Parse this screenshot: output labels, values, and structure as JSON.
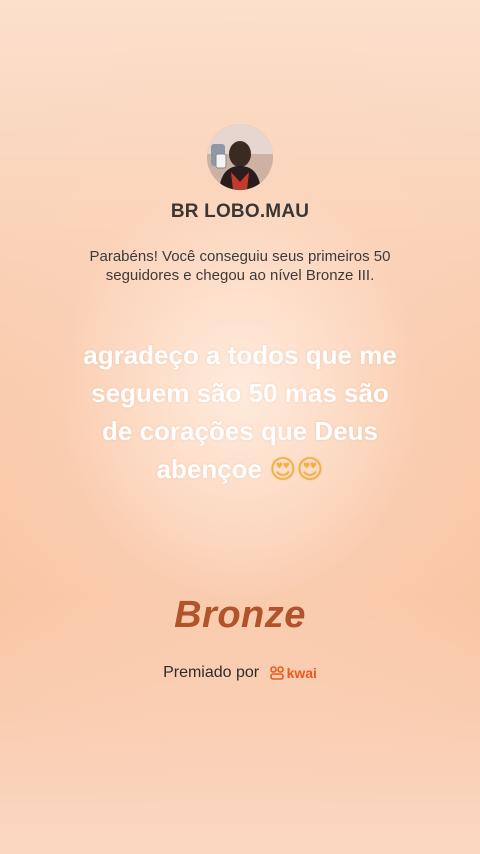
{
  "profile": {
    "avatar_icon": "user-avatar",
    "username": "BR LOBO.MAU"
  },
  "message": "Parabéns! Você conseguiu seus primeiros 50 seguidores e chegou ao nível Bronze III.",
  "caption": {
    "text": "agradeço a todos que me seguem são 50 mas são de corações que Deus abençoe",
    "emoji": "😍😍"
  },
  "badge": {
    "level": "Bronze"
  },
  "awarded_by": {
    "label": "Premiado por",
    "brand": "kwai",
    "brand_icon": "kwai-logo-icon",
    "brand_color": "#ea5a1e"
  },
  "colors": {
    "level_text": "#b1532b"
  }
}
